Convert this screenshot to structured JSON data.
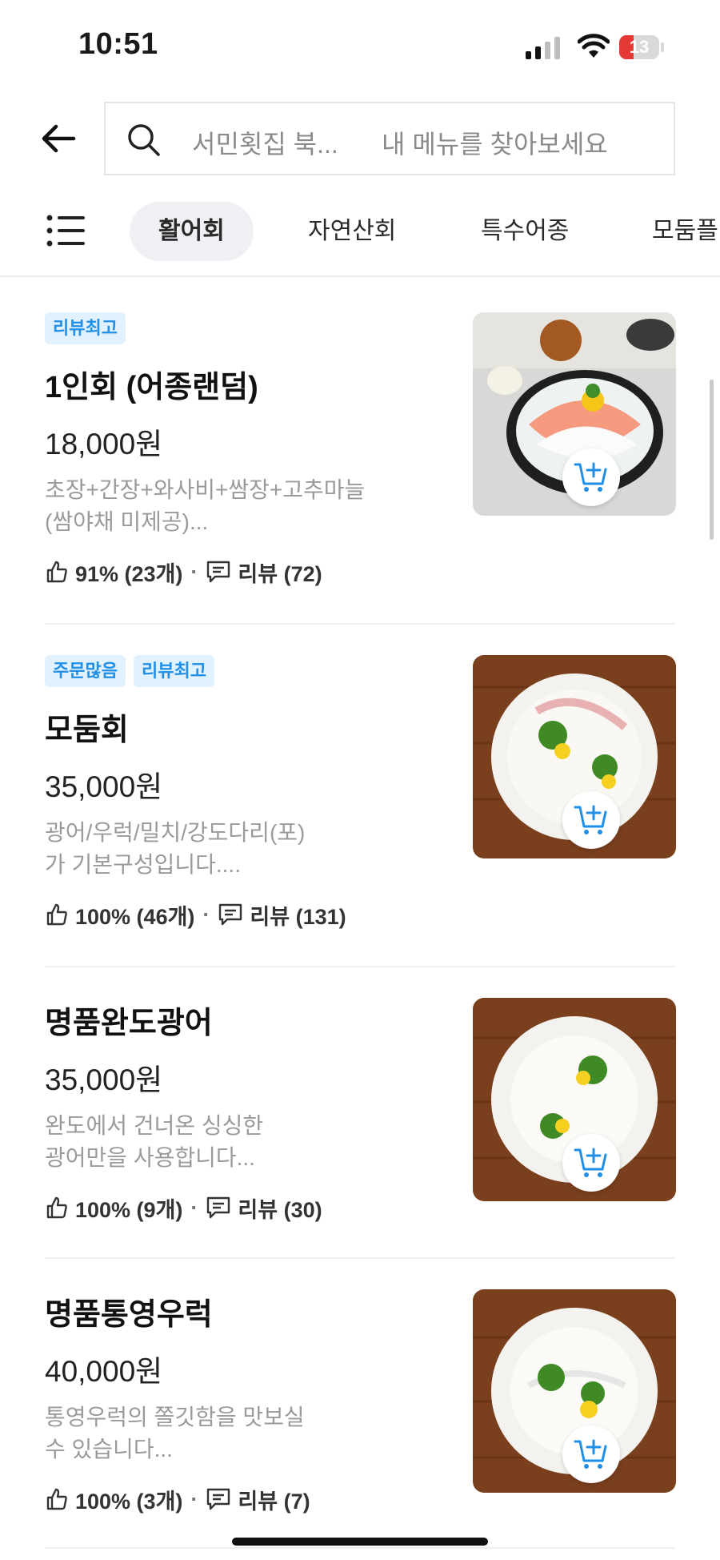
{
  "status_bar": {
    "time": "10:51",
    "battery": "13"
  },
  "search": {
    "store_name": "서민횟집 북...",
    "placeholder": "내 메뉴를 찾아보세요"
  },
  "categories": [
    "활어회",
    "자연산회",
    "특수어종",
    "모둠플"
  ],
  "active_category": "활어회",
  "items": [
    {
      "badges": [
        "리뷰최고"
      ],
      "name": "1인회 (어종랜덤)",
      "price": "18,000원",
      "desc_line1": "초장+간장+와사비+쌈장+고추마늘",
      "desc_line2": "(쌈야채 미제공)...",
      "like": "91% (23개)",
      "review": "리뷰 (72)"
    },
    {
      "badges": [
        "주문많음",
        "리뷰최고"
      ],
      "name": "모둠회",
      "price": "35,000원",
      "desc_line1": "광어/우럭/밀치/강도다리(포)",
      "desc_line2": "가 기본구성입니다....",
      "like": "100% (46개)",
      "review": "리뷰 (131)"
    },
    {
      "badges": [],
      "name": "명품완도광어",
      "price": "35,000원",
      "desc_line1": "완도에서 건너온 싱싱한",
      "desc_line2": "광어만을 사용합니다...",
      "like": "100% (9개)",
      "review": "리뷰 (30)"
    },
    {
      "badges": [],
      "name": "명품통영우럭",
      "price": "40,000원",
      "desc_line1": "통영우럭의 쫄깃함을 맛보실",
      "desc_line2": "수 있습니다...",
      "like": "100% (3개)",
      "review": "리뷰 (7)"
    }
  ],
  "colors": {
    "accent": "#1f8fe8",
    "badge_bg": "#e1f1fd",
    "muted_text": "#9a9a9a"
  }
}
